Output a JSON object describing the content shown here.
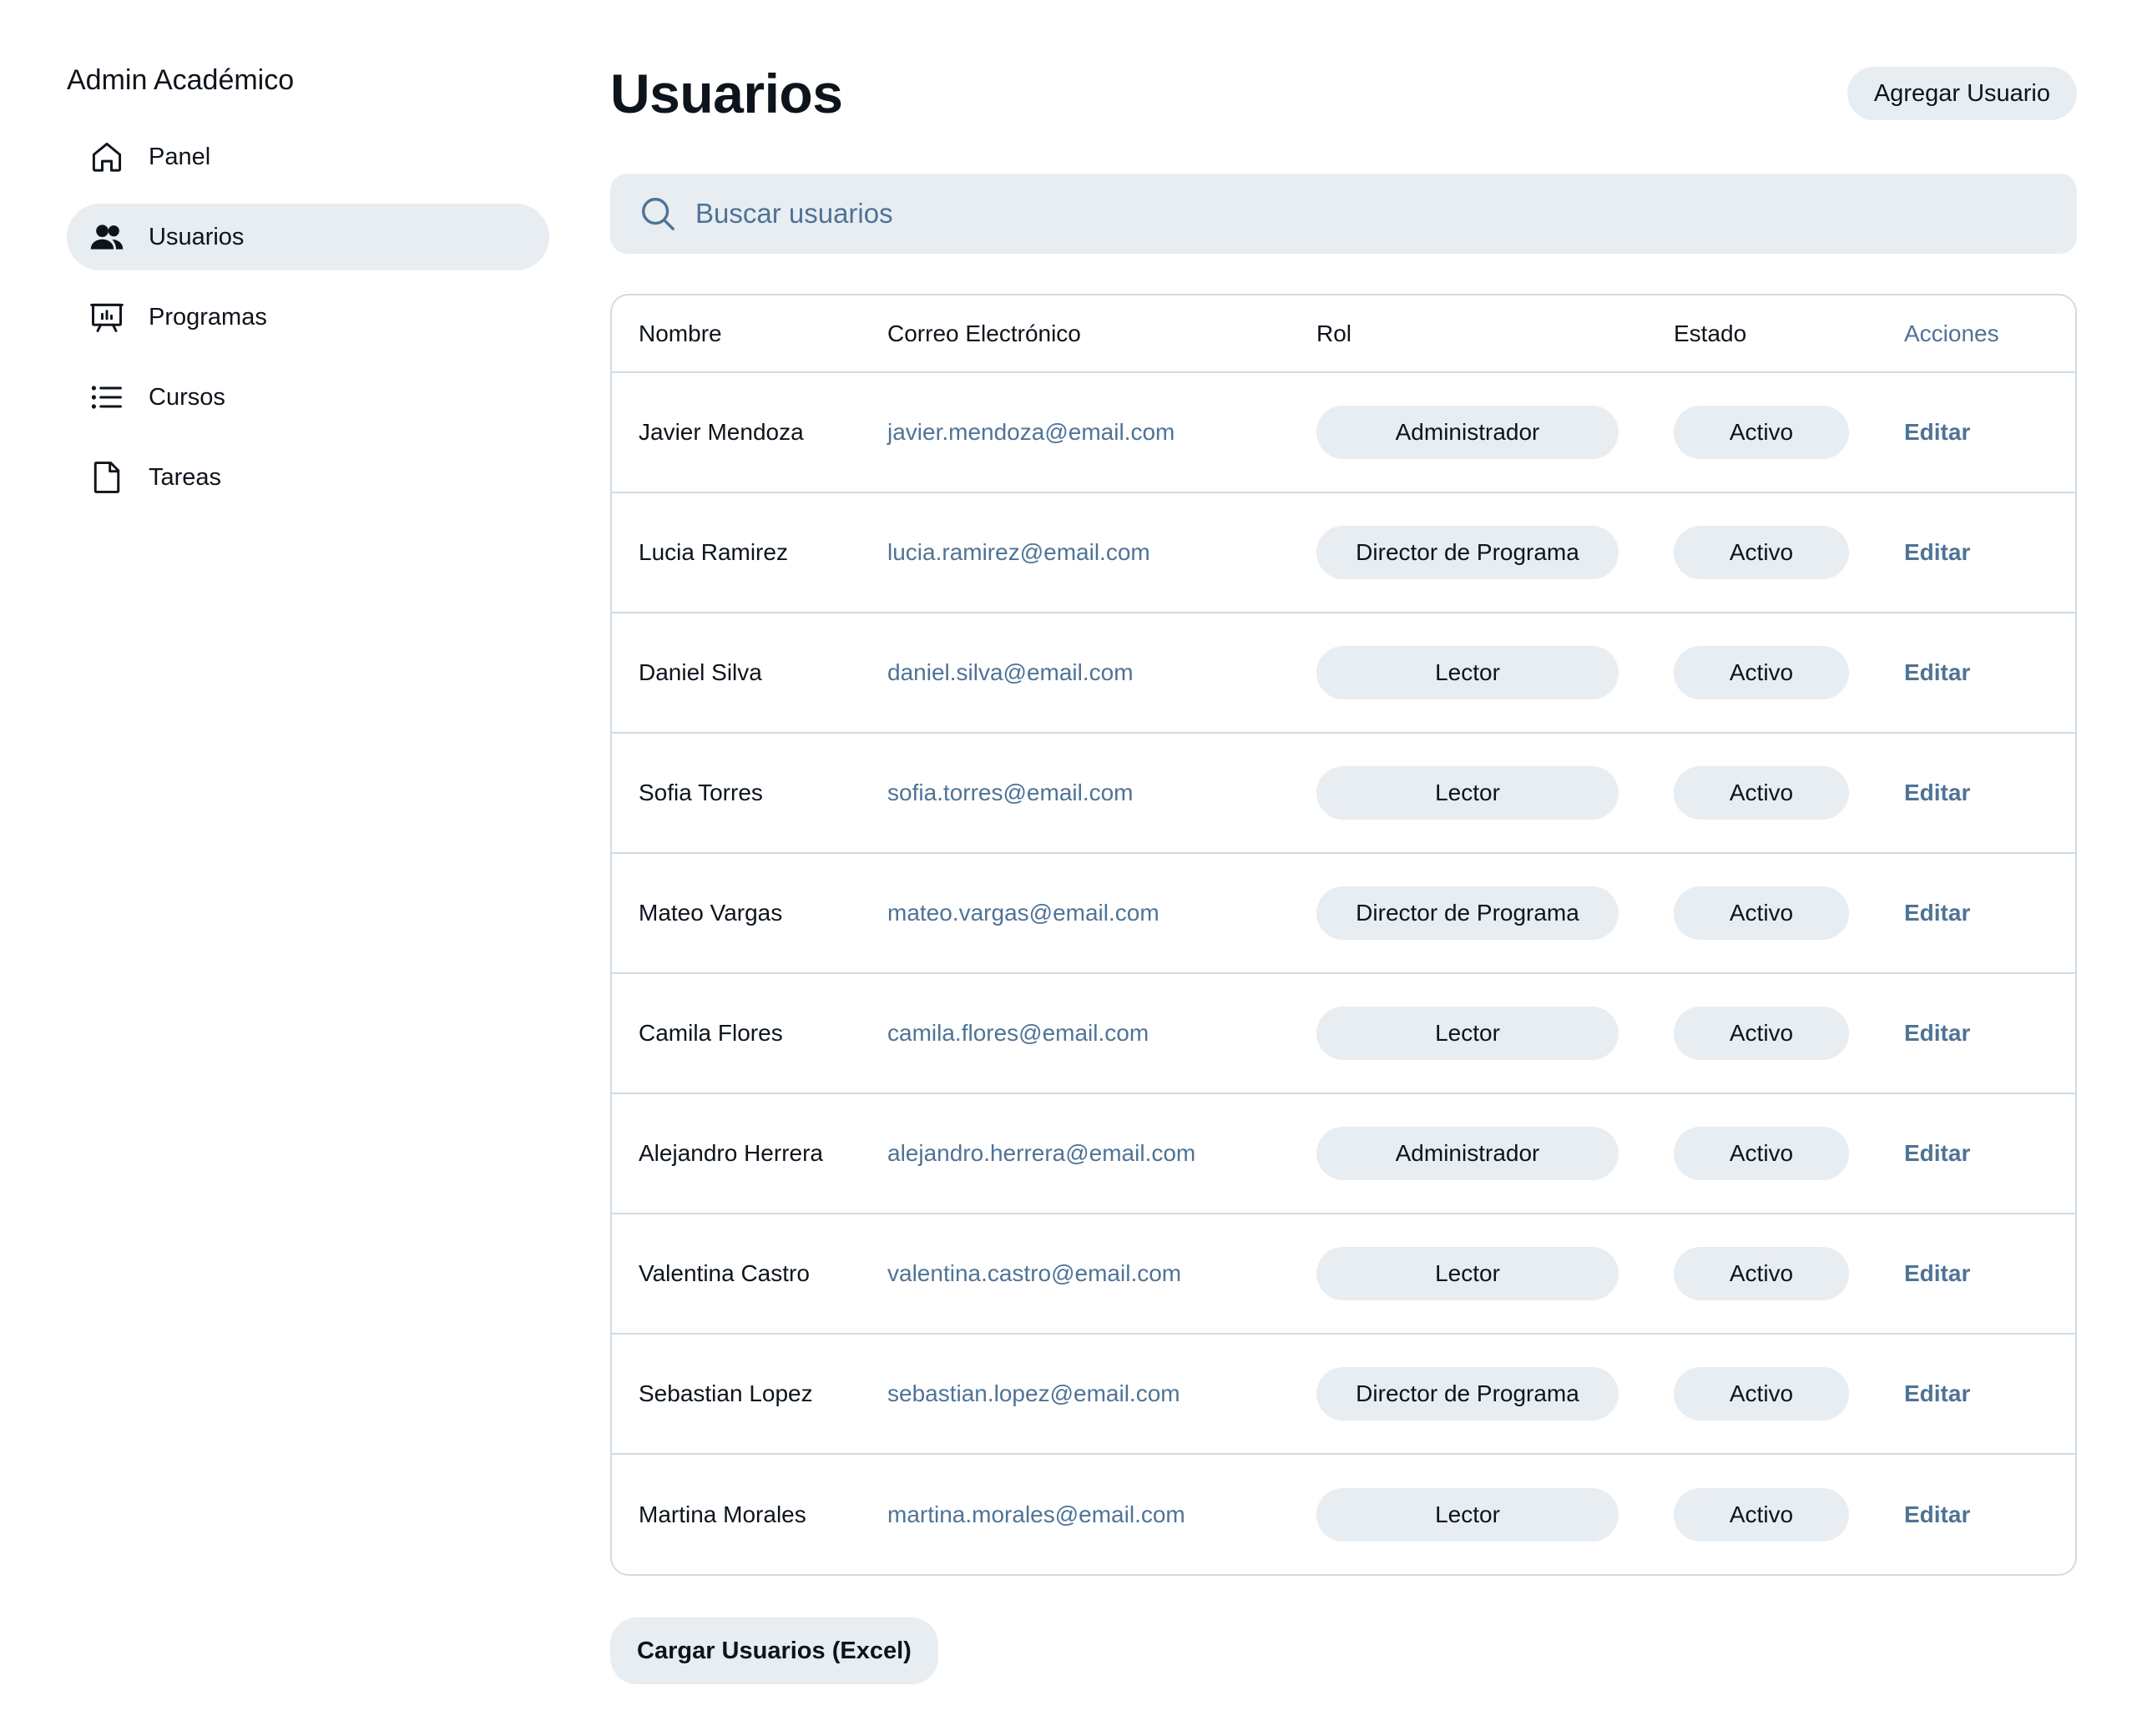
{
  "sidebar": {
    "brand": "Admin Académico",
    "items": [
      {
        "label": "Panel",
        "icon": "home-icon",
        "active": false
      },
      {
        "label": "Usuarios",
        "icon": "users-icon",
        "active": true
      },
      {
        "label": "Programas",
        "icon": "presentation-icon",
        "active": false
      },
      {
        "label": "Cursos",
        "icon": "list-icon",
        "active": false
      },
      {
        "label": "Tareas",
        "icon": "file-icon",
        "active": false
      }
    ]
  },
  "header": {
    "title": "Usuarios",
    "add_button": "Agregar Usuario"
  },
  "search": {
    "placeholder": "Buscar usuarios",
    "value": ""
  },
  "table": {
    "columns": [
      "Nombre",
      "Correo Electrónico",
      "Rol",
      "Estado",
      "Acciones"
    ],
    "rows": [
      {
        "name": "Javier Mendoza",
        "email": "javier.mendoza@email.com",
        "role": "Administrador",
        "status": "Activo",
        "action": "Editar"
      },
      {
        "name": "Lucia Ramirez",
        "email": "lucia.ramirez@email.com",
        "role": "Director de Programa",
        "status": "Activo",
        "action": "Editar"
      },
      {
        "name": "Daniel Silva",
        "email": "daniel.silva@email.com",
        "role": "Lector",
        "status": "Activo",
        "action": "Editar"
      },
      {
        "name": "Sofia Torres",
        "email": "sofia.torres@email.com",
        "role": "Lector",
        "status": "Activo",
        "action": "Editar"
      },
      {
        "name": "Mateo Vargas",
        "email": "mateo.vargas@email.com",
        "role": "Director de Programa",
        "status": "Activo",
        "action": "Editar"
      },
      {
        "name": "Camila Flores",
        "email": "camila.flores@email.com",
        "role": "Lector",
        "status": "Activo",
        "action": "Editar"
      },
      {
        "name": "Alejandro Herrera",
        "email": "alejandro.herrera@email.com",
        "role": "Administrador",
        "status": "Activo",
        "action": "Editar"
      },
      {
        "name": "Valentina Castro",
        "email": "valentina.castro@email.com",
        "role": "Lector",
        "status": "Activo",
        "action": "Editar"
      },
      {
        "name": "Sebastian Lopez",
        "email": "sebastian.lopez@email.com",
        "role": "Director de Programa",
        "status": "Activo",
        "action": "Editar"
      },
      {
        "name": "Martina Morales",
        "email": "martina.morales@email.com",
        "role": "Lector",
        "status": "Activo",
        "action": "Editar"
      }
    ]
  },
  "upload_button": "Cargar Usuarios (Excel)",
  "colors": {
    "text": "#0d141c",
    "muted": "#4f7396",
    "chip_bg": "#e8edf2",
    "border": "#d0dbe6"
  }
}
